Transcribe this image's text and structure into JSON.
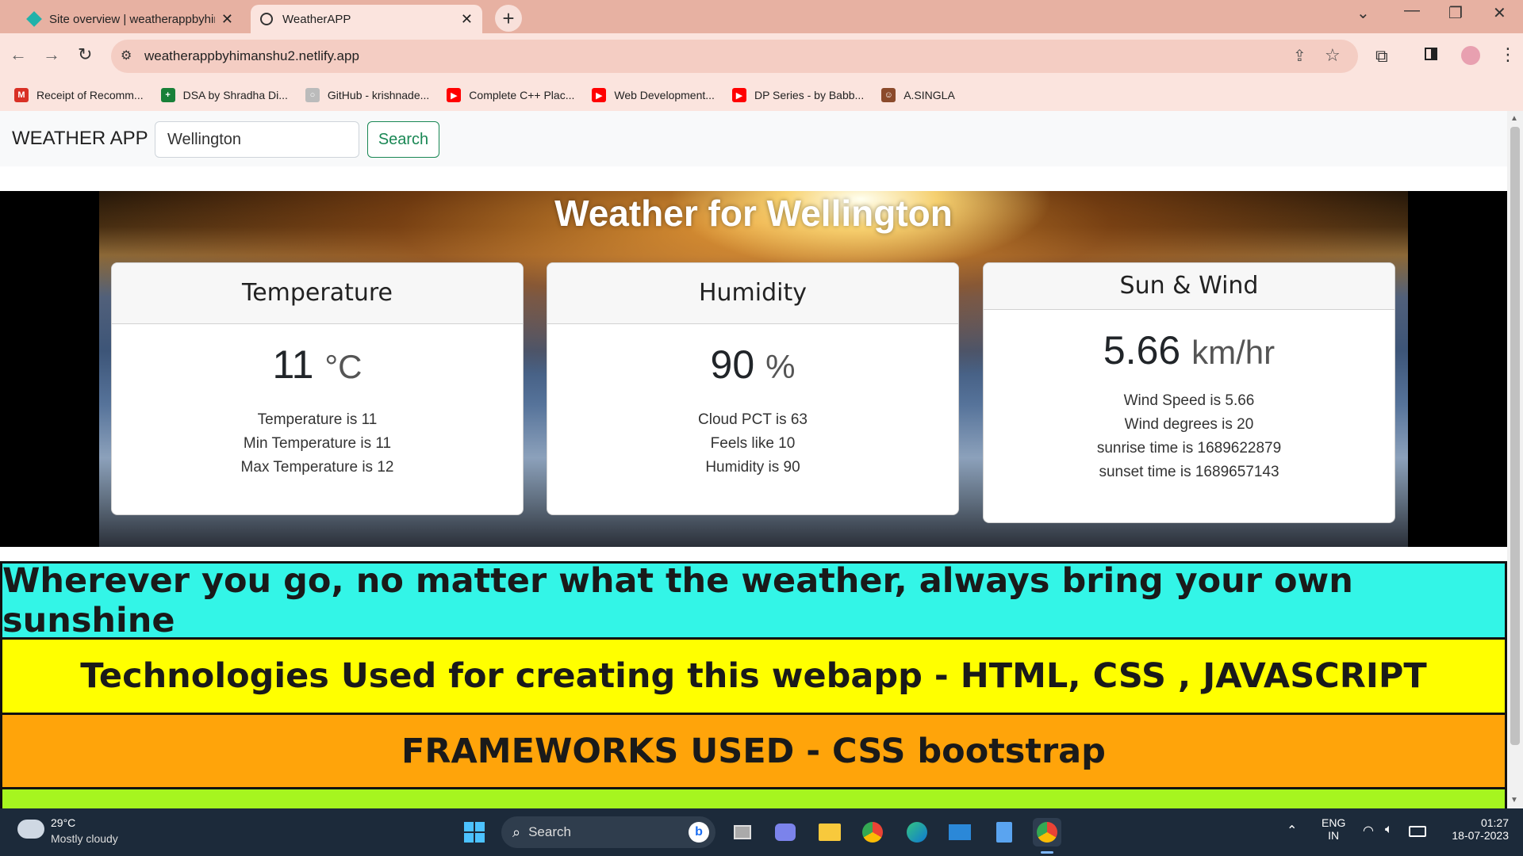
{
  "browser": {
    "tabs": [
      {
        "title": "Site overview | weatherappbyhimanshu2",
        "active": false
      },
      {
        "title": "WeatherAPP",
        "active": true
      }
    ],
    "url": "weatherappbyhimanshu2.netlify.app",
    "bookmarks": [
      {
        "label": "Receipt of Recomm...",
        "icon": "gmail-icon",
        "color": "#d93025",
        "glyph": "M"
      },
      {
        "label": "DSA by Shradha Di...",
        "icon": "sheets-icon",
        "color": "#188038",
        "glyph": "+"
      },
      {
        "label": "GitHub - krishnade...",
        "icon": "github-icon",
        "color": "#bbbbbb",
        "glyph": "○"
      },
      {
        "label": "Complete C++ Plac...",
        "icon": "youtube-icon",
        "color": "#ff0000",
        "glyph": "▶"
      },
      {
        "label": "Web Development...",
        "icon": "youtube-icon",
        "color": "#ff0000",
        "glyph": "▶"
      },
      {
        "label": "DP Series - by Babb...",
        "icon": "youtube-icon",
        "color": "#ff0000",
        "glyph": "▶"
      },
      {
        "label": "A.SINGLA",
        "icon": "avatar-icon",
        "color": "#8b4a2b",
        "glyph": "☺"
      }
    ]
  },
  "navbar": {
    "brand": "WEATHER APP",
    "search_value": "Wellington",
    "search_button": "Search"
  },
  "hero": {
    "title": "Weather for Wellington"
  },
  "cards": {
    "temperature": {
      "header": "Temperature",
      "value": "11",
      "unit": "°C",
      "lines": [
        "Temperature is 11",
        "Min Temperature is 11",
        "Max Temperature is 12"
      ]
    },
    "humidity": {
      "header": "Humidity",
      "value": "90",
      "unit": "%",
      "lines": [
        "Cloud PCT is 63",
        "Feels like 10",
        "Humidity is 90"
      ]
    },
    "wind": {
      "header": "Sun & Wind",
      "value": "5.66",
      "unit": "km/hr",
      "lines": [
        "Wind Speed is 5.66",
        "Wind degrees is 20",
        "sunrise time is 1689622879",
        "sunset time is 1689657143"
      ]
    }
  },
  "bands": {
    "quote": "Wherever you go, no matter what the weather, always bring your own sunshine",
    "technologies": "Technologies Used for creating this webapp - HTML, CSS , JAVASCRIPT",
    "frameworks": "FRAMEWORKS USED - CSS bootstrap"
  },
  "colors": {
    "band_cyan": "#33f5e7",
    "band_yellow": "#ffff00",
    "band_orange": "#ffa40a",
    "band_green": "#a6f51f",
    "search_button": "#198754"
  },
  "taskbar": {
    "weather_temp": "29°C",
    "weather_desc": "Mostly cloudy",
    "search_label": "Search",
    "lang_line1": "ENG",
    "lang_line2": "IN",
    "time": "01:27",
    "date": "18-07-2023"
  }
}
